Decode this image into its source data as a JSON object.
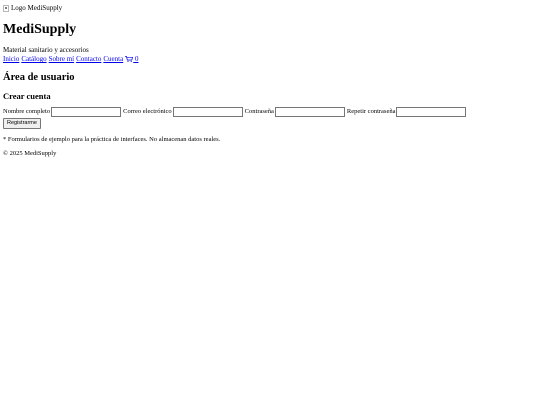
{
  "header": {
    "logo_alt": "Logo MediSupply",
    "site_title": "MediSupply",
    "tagline": "Material sanitario y accesorios"
  },
  "nav": {
    "items": [
      {
        "label": "Inicio"
      },
      {
        "label": "Catálogo"
      },
      {
        "label": "Sobre mí"
      },
      {
        "label": "Contacto"
      },
      {
        "label": "Cuenta"
      }
    ],
    "cart_icon": "cart-icon",
    "cart_count": "0"
  },
  "main": {
    "section_title": "Área de usuario",
    "form": {
      "title": "Crear cuenta",
      "fields": [
        {
          "label": "Nombre completo",
          "value": ""
        },
        {
          "label": "Correo electrónico",
          "value": ""
        },
        {
          "label": "Contraseña",
          "value": ""
        },
        {
          "label": "Repetir contraseña",
          "value": ""
        }
      ],
      "submit_label": "Registrarme"
    },
    "note": "* Formularios de ejemplo para la práctica de interfaces. No almacenan datos reales."
  },
  "footer": {
    "copyright": "© 2025 MediSupply"
  },
  "colors": {
    "link": "#0000ee",
    "text": "#000000",
    "background": "#ffffff"
  }
}
